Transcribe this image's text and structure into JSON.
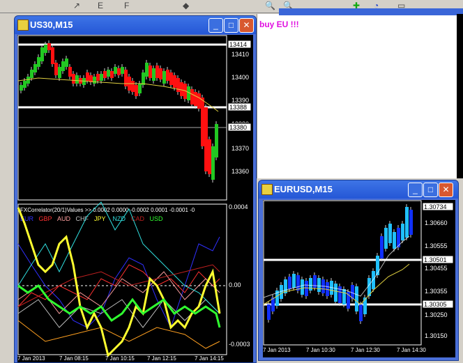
{
  "toolbar": {
    "icons": [
      "arrow-icon",
      "period-icon",
      "zoom-in-icon",
      "zoom-out-icon",
      "add-icon",
      "timer-icon",
      "screenshot-icon"
    ]
  },
  "comment_text": "buy EU !!!",
  "us30": {
    "title": "US30,M15",
    "price_axis": [
      "13410",
      "13400",
      "13390",
      "13380",
      "13370",
      "13360"
    ],
    "tags": [
      "13414",
      "13388",
      "13380"
    ],
    "indicator_header": "FXCorrelator(20/1)Values >> 0.0002 0.0000 -0.0002 0.0001 -0.0001 -0",
    "currencies": [
      {
        "name": "EUR",
        "color": "#3030ff"
      },
      {
        "name": "GBP",
        "color": "#ff3030"
      },
      {
        "name": "AUD",
        "color": "#ffa0a0"
      },
      {
        "name": "CHF",
        "color": "#c0c0c0"
      },
      {
        "name": "JPY",
        "color": "#ffff30"
      },
      {
        "name": "NZD",
        "color": "#30e0e0"
      },
      {
        "name": "CAD",
        "color": "#c02020"
      },
      {
        "name": "USD",
        "color": "#30ff30"
      }
    ],
    "ind_axis": [
      "0.0004",
      "0.00",
      "-0.0003"
    ],
    "time_axis": [
      "7 Jan 2013",
      "7 Jan 08:15",
      "7 Jan 10:15",
      "7 Jan 12:15",
      "7 Jan 14:15"
    ]
  },
  "eurusd": {
    "title": "EURUSD,M15",
    "price_axis": [
      "1.30660",
      "1.30555",
      "1.30455",
      "1.30355",
      "1.30250",
      "1.30150"
    ],
    "tags": [
      "1.30734",
      "1.30501",
      "1.30305"
    ],
    "time_axis": [
      "7 Jan 2013",
      "7 Jan 10:30",
      "7 Jan 12:30",
      "7 Jan 14:30"
    ]
  },
  "colors": {
    "bull": "#22c822",
    "bear": "#ff1010",
    "eur_bull": "#20c0ff",
    "eur_bear": "#1030ff",
    "ma": "#e0d040"
  }
}
